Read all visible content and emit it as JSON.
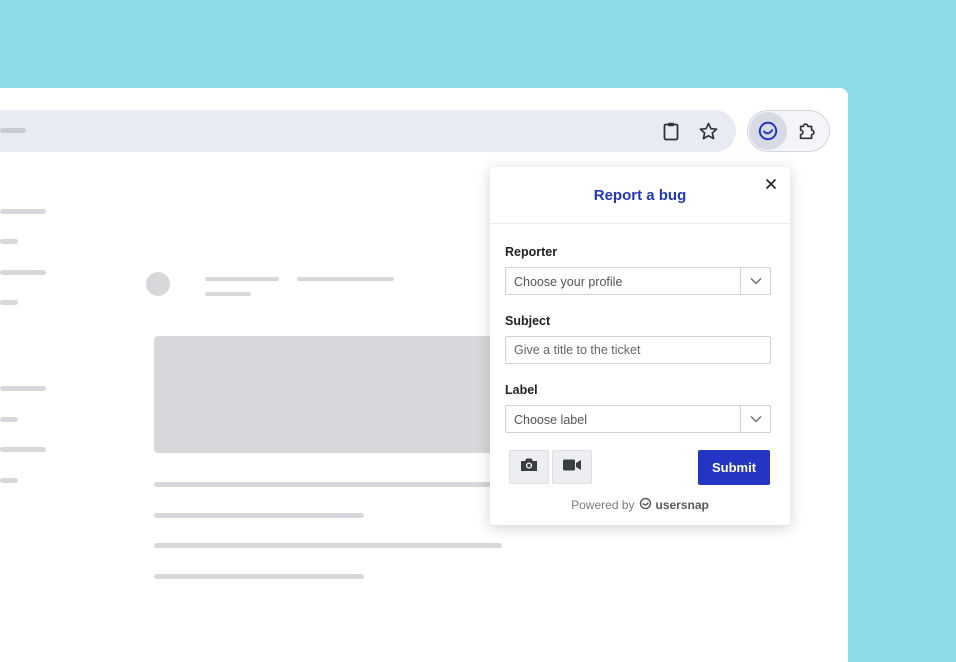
{
  "colors": {
    "background": "#8ddbe6",
    "accent": "#2434c4",
    "title": "#2537b8"
  },
  "toolbar": {
    "icons": [
      "clipboard-icon",
      "star-icon",
      "usersnap-extension-icon",
      "puzzle-icon"
    ]
  },
  "popup": {
    "title": "Report a bug",
    "close_icon": "close-icon",
    "reporter": {
      "label": "Reporter",
      "value": "Choose your profile"
    },
    "subject": {
      "label": "Subject",
      "placeholder": "Give a title to the ticket"
    },
    "label_field": {
      "label": "Label",
      "value": "Choose label"
    },
    "capture_buttons": [
      "camera-icon",
      "video-icon"
    ],
    "submit_label": "Submit",
    "powered_by": "Powered by",
    "brand": "usersnap"
  }
}
